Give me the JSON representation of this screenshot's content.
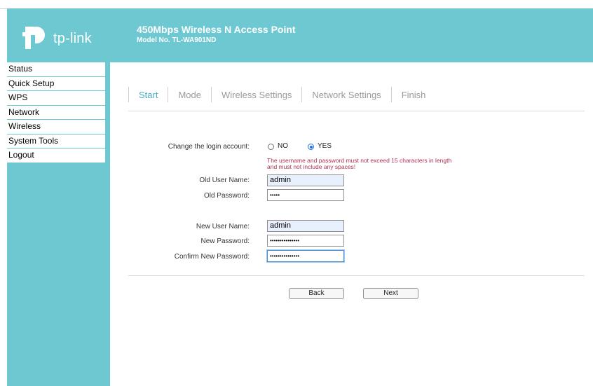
{
  "header": {
    "brand": "tp-link",
    "title": "450Mbps Wireless N Access Point",
    "model": "Model No. TL-WA901ND"
  },
  "sidebar": {
    "items": [
      {
        "label": "Status"
      },
      {
        "label": "Quick Setup"
      },
      {
        "label": "WPS"
      },
      {
        "label": "Network"
      },
      {
        "label": "Wireless"
      },
      {
        "label": "System Tools"
      },
      {
        "label": "Logout"
      }
    ]
  },
  "steps": [
    {
      "label": "Start",
      "active": true
    },
    {
      "label": "Mode",
      "active": false
    },
    {
      "label": "Wireless Settings",
      "active": false
    },
    {
      "label": "Network Settings",
      "active": false
    },
    {
      "label": "Finish",
      "active": false
    }
  ],
  "form": {
    "change_login_label": "Change the login account:",
    "option_no": "NO",
    "option_yes": "YES",
    "selected": "YES",
    "warning_line1": "The username and password must not exceed 15 characters in length",
    "warning_line2": "and must not include any spaces!",
    "old_user_label": "Old User Name:",
    "old_user_value": "admin",
    "old_pass_label": "Old Password:",
    "old_pass_value": "•••••",
    "new_user_label": "New User Name:",
    "new_user_value": "admin",
    "new_pass_label": "New Password:",
    "new_pass_value": "•••••••••••••••",
    "confirm_pass_label": "Confirm New Password:",
    "confirm_pass_value": "•••••••••••••••"
  },
  "buttons": {
    "back": "Back",
    "next": "Next"
  },
  "colors": {
    "brand_teal": "#6dc8d2",
    "active_step": "#4aaec0",
    "warning": "#b03050"
  }
}
